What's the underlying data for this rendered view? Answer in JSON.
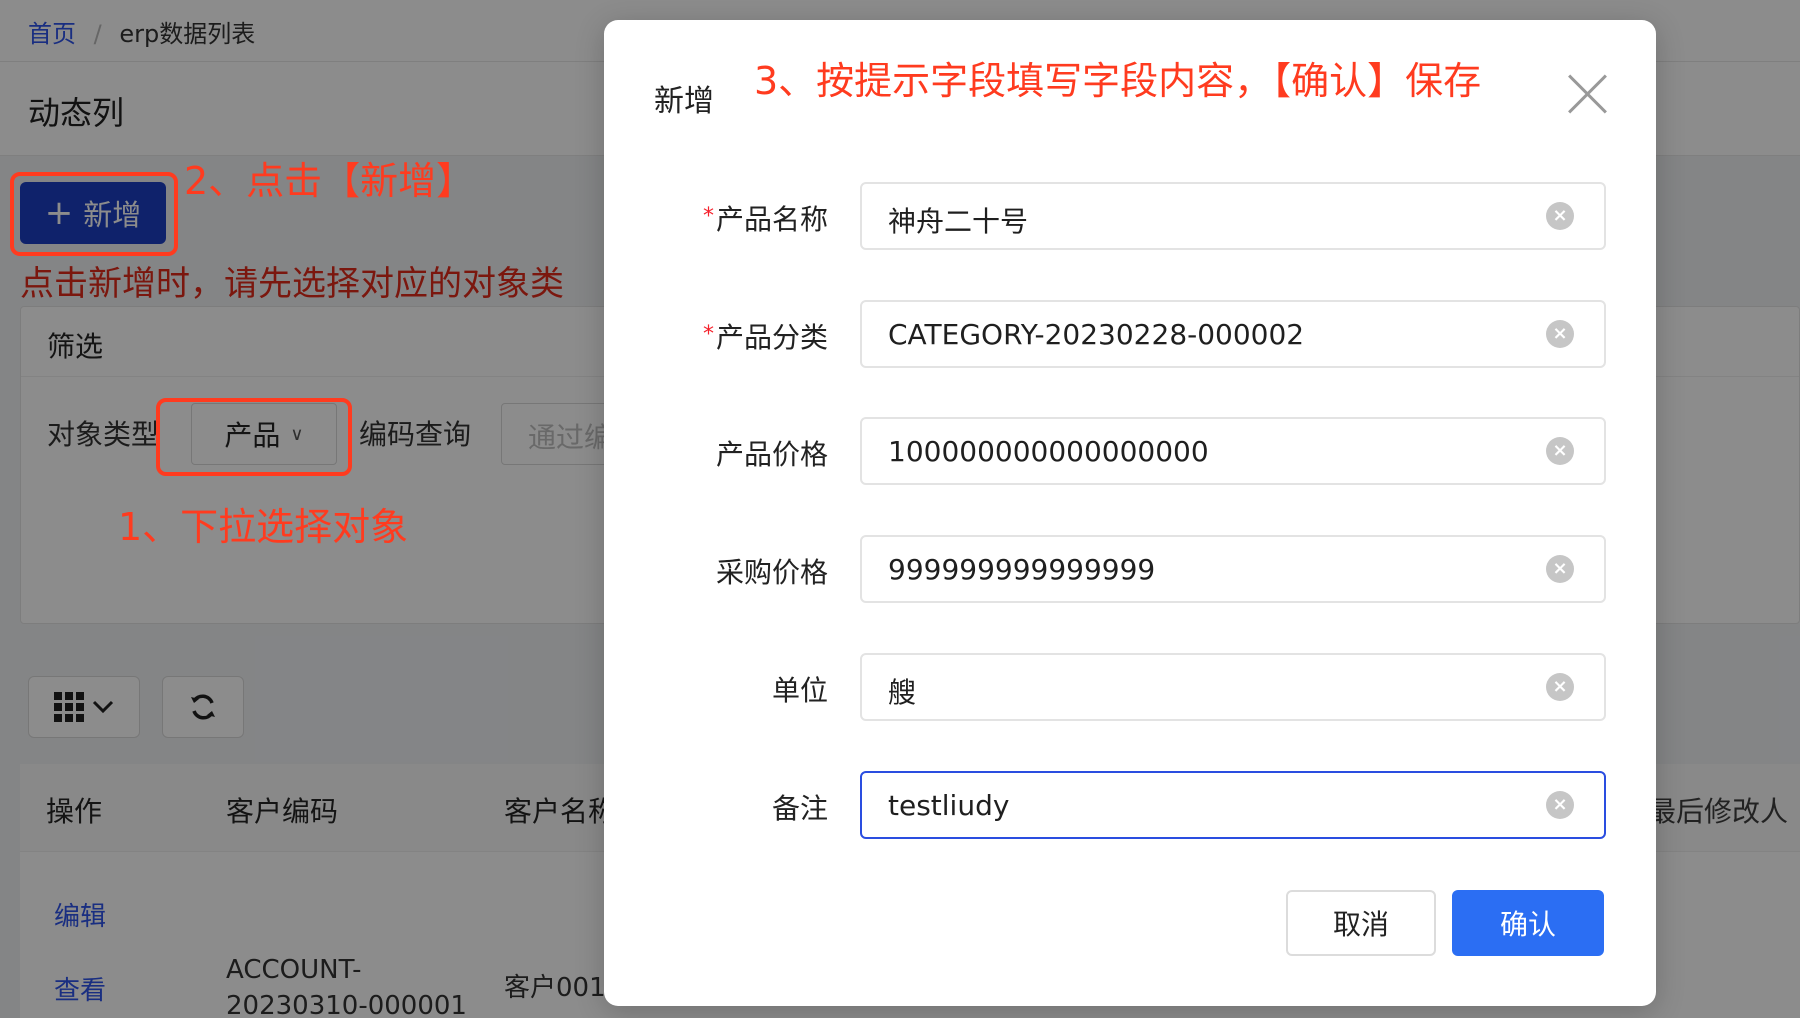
{
  "breadcrumb": {
    "home": "首页",
    "separator": "/",
    "current": "erp数据列表"
  },
  "page_title": "动态列",
  "toolbar": {
    "add_label": "新增",
    "add_icon": "plus-icon"
  },
  "hint": "点击新增时，请先选择对应的对象类",
  "filter": {
    "title": "筛选",
    "object_type_label": "对象类型",
    "object_type_value": "产品",
    "code_query_label": "编码查询",
    "code_query_placeholder": "通过编"
  },
  "table": {
    "headers": [
      "操作",
      "客户编码",
      "客户名称",
      "最后修改人"
    ],
    "row": {
      "actions": [
        "编辑",
        "查看"
      ],
      "code_line1": "ACCOUNT-",
      "code_line2": "20230310-000001",
      "name": "客户001"
    }
  },
  "annotations": {
    "step1": "1、下拉选择对象",
    "step2": "2、点击【新增】",
    "step3": "3、按提示字段填写字段内容，【确认】保存"
  },
  "modal": {
    "title": "新增",
    "fields": [
      {
        "label": "产品名称",
        "required": true,
        "value": "神舟二十号"
      },
      {
        "label": "产品分类",
        "required": true,
        "value": "CATEGORY-20230228-000002"
      },
      {
        "label": "产品价格",
        "required": false,
        "value": "100000000000000000"
      },
      {
        "label": "采购价格",
        "required": false,
        "value": "999999999999999"
      },
      {
        "label": "单位",
        "required": false,
        "value": "艘"
      },
      {
        "label": "备注",
        "required": false,
        "value": "testliudy"
      }
    ],
    "required_mark": "*",
    "cancel_label": "取消",
    "confirm_label": "确认"
  },
  "colors": {
    "primary": "#2b6ef3",
    "annotation": "#ff3b1f",
    "link": "#2f54eb"
  }
}
